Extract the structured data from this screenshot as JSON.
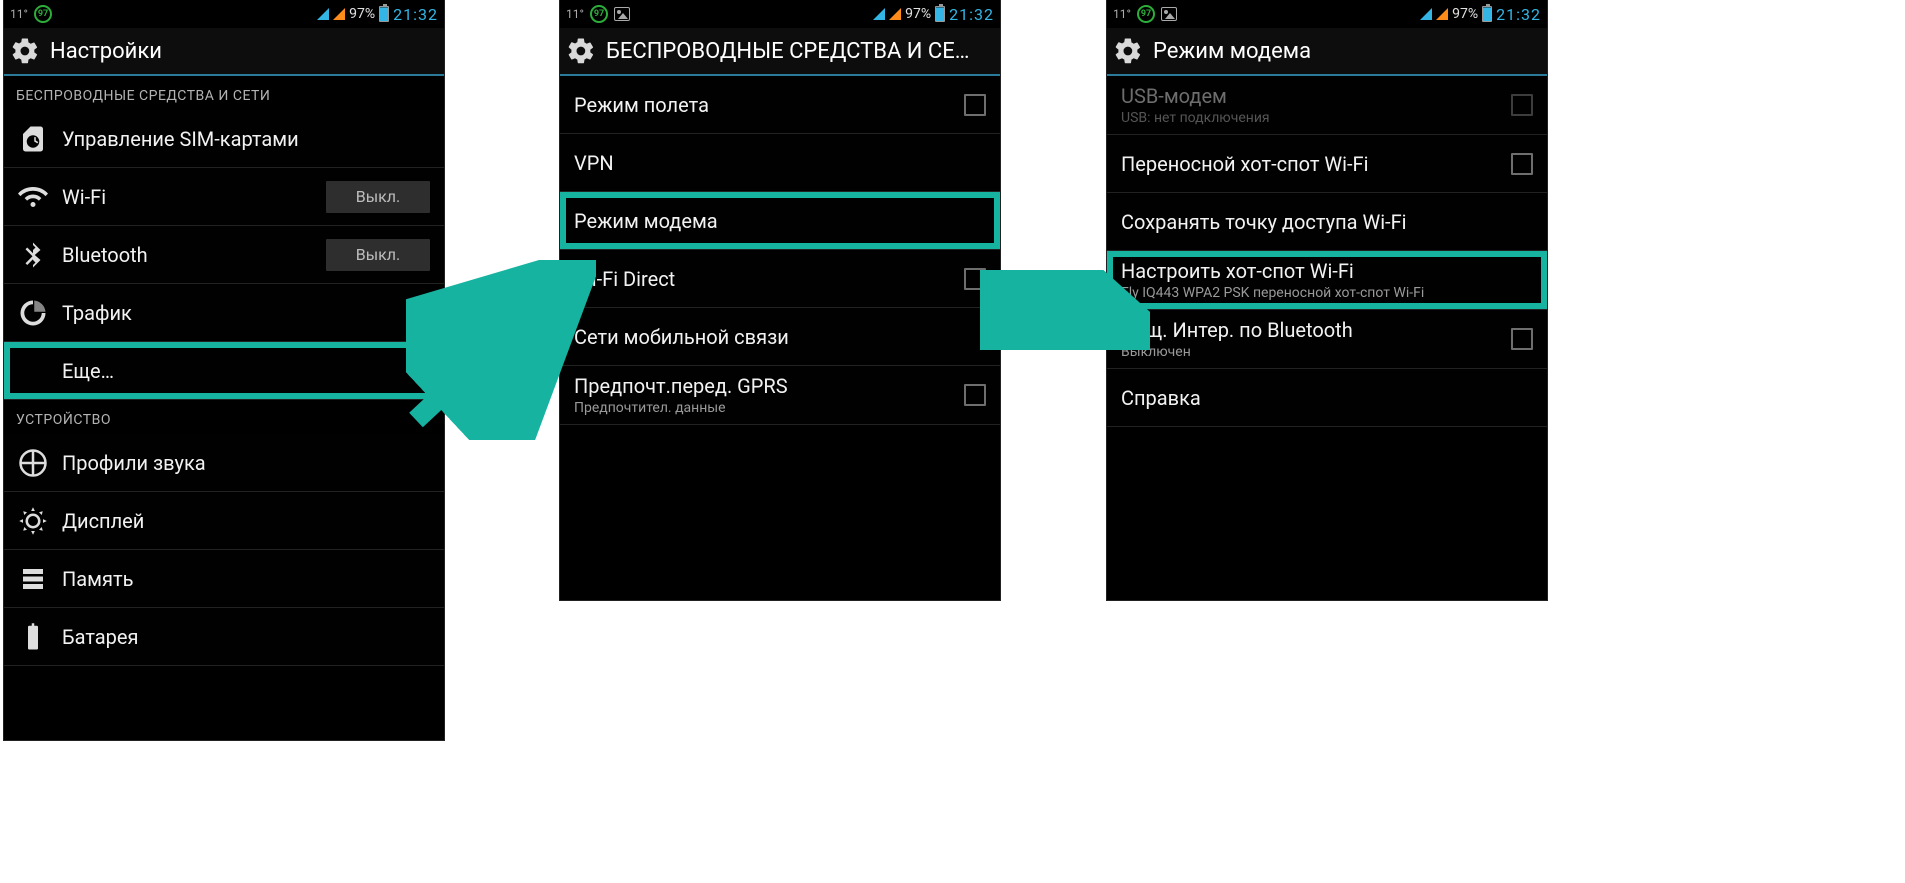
{
  "status": {
    "temp": "11°",
    "license": "97",
    "battery_pct": "97%",
    "clock": "21:32"
  },
  "accent_highlight": "#17b3a1",
  "phone1": {
    "title": "Настройки",
    "section1": "БЕСПРОВОДНЫЕ СРЕДСТВА И СЕТИ",
    "row_sim": "Управление SIM-картами",
    "row_wifi": "Wi-Fi",
    "row_bt": "Bluetooth",
    "toggle_off": "Выкл.",
    "row_traffic": "Трафик",
    "row_more": "Еще…",
    "section2": "УСТРОЙСТВО",
    "row_sound": "Профили звука",
    "row_display": "Дисплей",
    "row_memory": "Память",
    "row_battery": "Батарея"
  },
  "phone2": {
    "title": "БЕСПРОВОДНЫЕ СРЕДСТВА И СЕ…",
    "row_airplane": "Режим полета",
    "row_vpn": "VPN",
    "row_tether": "Режим модема",
    "row_wifidirect": "Wi-Fi Direct",
    "row_mobile": "Сети мобильной связи",
    "row_gprs": "Предпочт.перед. GPRS",
    "row_gprs_sub": "Предпочтител. данные"
  },
  "phone3": {
    "title": "Режим модема",
    "row_usb": "USB-модем",
    "row_usb_sub": "USB: нет подключения",
    "row_hotspot": "Переносной хот-спот Wi-Fi",
    "row_keep": "Сохранять точку доступа Wi-Fi",
    "row_cfg": "Настроить хот-спот Wi-Fi",
    "row_cfg_sub": "Fly IQ443 WPA2 PSK переносной хот-спот Wi-Fi",
    "row_btnet": "Общ. Интер. по Bluetooth",
    "row_btnet_sub": "Выключен",
    "row_help": "Справка"
  }
}
